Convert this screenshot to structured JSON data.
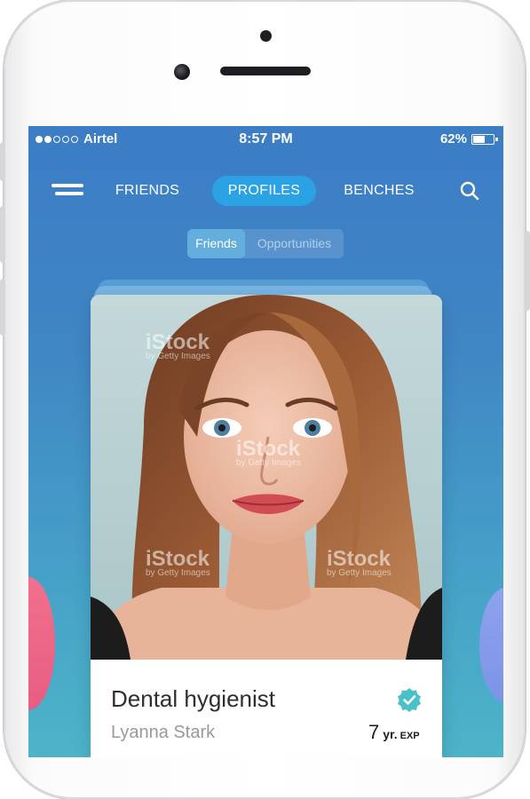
{
  "status_bar": {
    "carrier": "Airtel",
    "time": "8:57 PM",
    "battery": "62%",
    "battery_level": 0.62
  },
  "nav": {
    "tabs": [
      {
        "label": "FRIENDS",
        "active": false
      },
      {
        "label": "PROFILES",
        "active": true
      },
      {
        "label": "BENCHES",
        "active": false
      }
    ],
    "menu_icon": "hamburger-menu-icon",
    "search_icon": "search-icon"
  },
  "segmented": {
    "items": [
      "Friends",
      "Opportunities"
    ],
    "selected": "Friends"
  },
  "card": {
    "title": "Dental hygienist",
    "name": "Lyanna Stark",
    "experience_value": "7",
    "experience_unit": "yr.",
    "experience_label": "EXP",
    "verified_icon": "verified-badge-icon",
    "photo_watermark": "iStock",
    "photo_watermark_sub": "by Getty Images"
  },
  "colors": {
    "background_top": "#3c7dc6",
    "background_bottom": "#4db4c8",
    "active_tab": "#2aa2e4",
    "verified": "#4bc0c8",
    "blob_left": "#ee6a8a",
    "blob_right": "#8a9fec"
  }
}
